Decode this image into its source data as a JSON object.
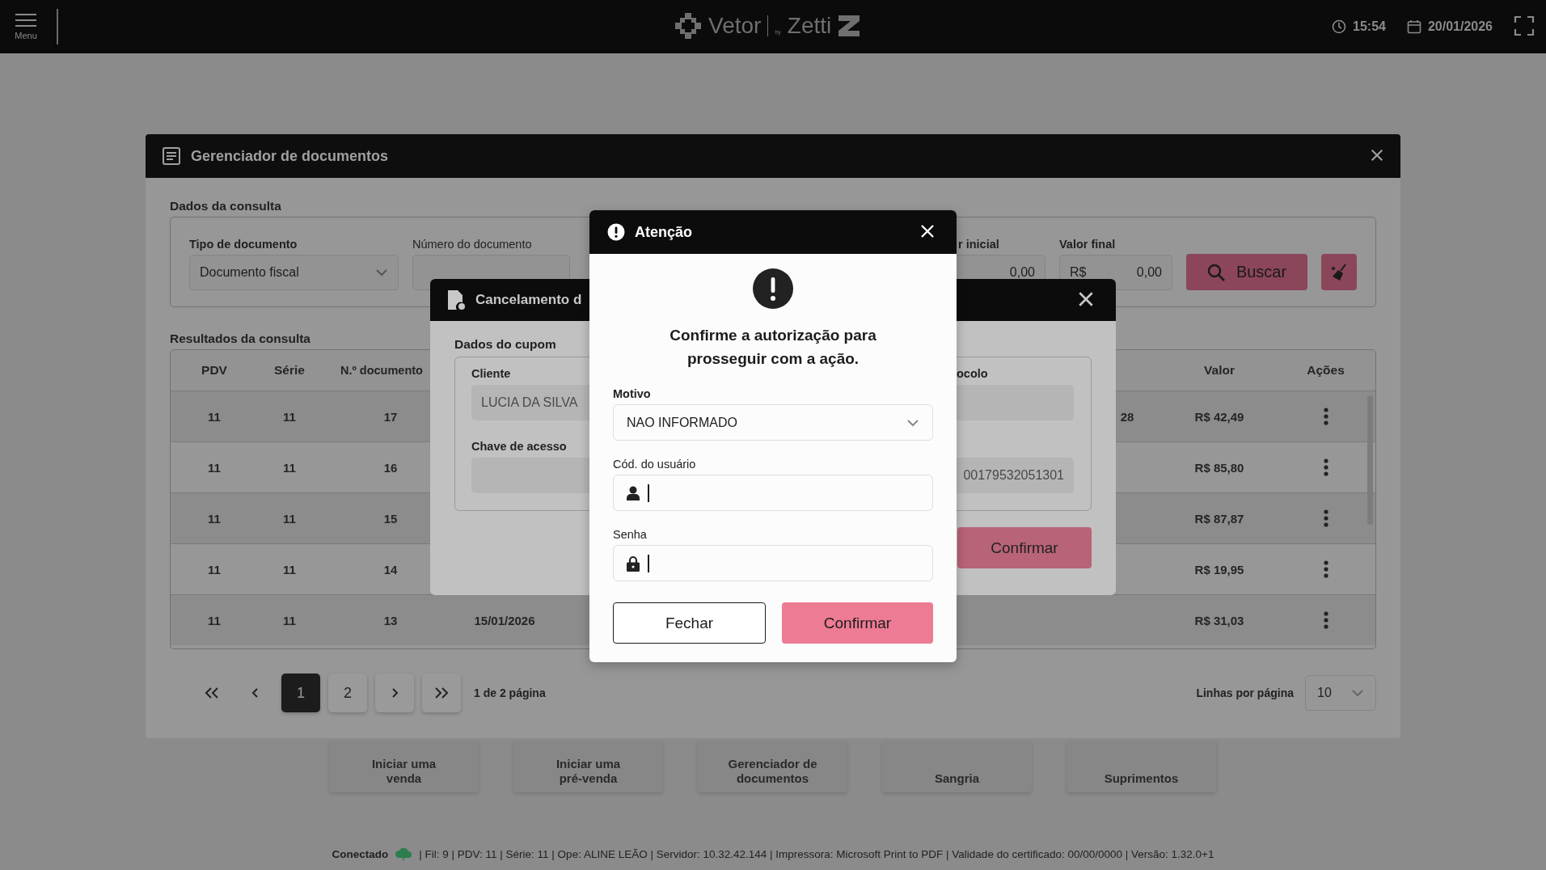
{
  "topbar": {
    "menu_label": "Menu",
    "logo": {
      "left": "Vetor",
      "by": "by",
      "right": "Zetti"
    },
    "time": "15:54",
    "date": "20/01/2026"
  },
  "home_tiles": [
    {
      "lines": [
        "Iniciar uma",
        "venda"
      ]
    },
    {
      "lines": [
        "Iniciar uma",
        "pré-venda"
      ]
    },
    {
      "lines": [
        "Gerenciador de",
        "documentos"
      ]
    },
    {
      "lines": [
        "Sangria"
      ]
    },
    {
      "lines": [
        "Suprimentos"
      ]
    }
  ],
  "status_bar": {
    "state": "Conectado",
    "connected": true,
    "details": "| Fil: 9 | PDV: 11 | Série: 11 | Ope: ALINE LEÃO | Servidor: 10.32.42.144 | Impressora: Microsoft Print to PDF | Validade do certificado: 00/00/0000 | Versão: 1.32.0+1"
  },
  "document_manager": {
    "title": "Gerenciador de documentos",
    "query": {
      "title": "Dados da consulta",
      "fields": [
        {
          "kind": "select",
          "label": "Tipo de documento",
          "value": "Documento fiscal"
        },
        {
          "kind": "text",
          "label": "Número do documento"
        },
        {
          "kind": "currency",
          "label": "r inicial",
          "value": "0,00"
        },
        {
          "kind": "currency",
          "label": "Valor final",
          "prefix": "R$",
          "value": "0,00"
        }
      ],
      "search_button": "Buscar"
    },
    "results": {
      "title": "Resultados da consulta",
      "columns": [
        "PDV",
        "Série",
        "N.º documento",
        "Valor",
        "Ações"
      ],
      "rows": [
        {
          "pdv": "11",
          "serie": "11",
          "documento": "17",
          "column_5": "28",
          "valor": "R$ 42,49"
        },
        {
          "pdv": "11",
          "serie": "11",
          "documento": "16",
          "valor": "R$ 85,80"
        },
        {
          "pdv": "11",
          "serie": "11",
          "documento": "15",
          "valor": "R$ 87,87"
        },
        {
          "pdv": "11",
          "serie": "11",
          "documento": "14",
          "valor": "R$ 19,95"
        },
        {
          "pdv": "11",
          "serie": "11",
          "documento": "13",
          "column_4": "15/01/2026",
          "valor": "R$ 31,03"
        }
      ]
    },
    "pagination": {
      "pages": [
        {
          "label": "1",
          "selected": true
        },
        {
          "label": "2",
          "selected": false
        }
      ],
      "info": "1 de 2 página",
      "rows_per_page_label": "Linhas por página",
      "rows_per_page": "10"
    }
  },
  "cancel_dialog": {
    "title": "Cancelamento d",
    "section": "Dados do cupom",
    "left_fields": [
      {
        "label": "Cliente",
        "value": "LUCIA DA SILVA"
      },
      {
        "label": "Chave de acesso"
      }
    ],
    "right_fields": [
      {
        "label": "ocolo"
      },
      {
        "value": "00179532051301"
      }
    ],
    "confirm_button": "Confirmar"
  },
  "auth_dialog": {
    "title": "Atenção",
    "message": "Confirme a autorização para prosseguir com a ação.",
    "reason": {
      "label": "Motivo",
      "value": "NAO INFORMADO"
    },
    "user_code": {
      "label": "Cód. do usuário"
    },
    "password": {
      "label": "Senha"
    },
    "close_button": "Fechar",
    "confirm_button": "Confirmar"
  }
}
